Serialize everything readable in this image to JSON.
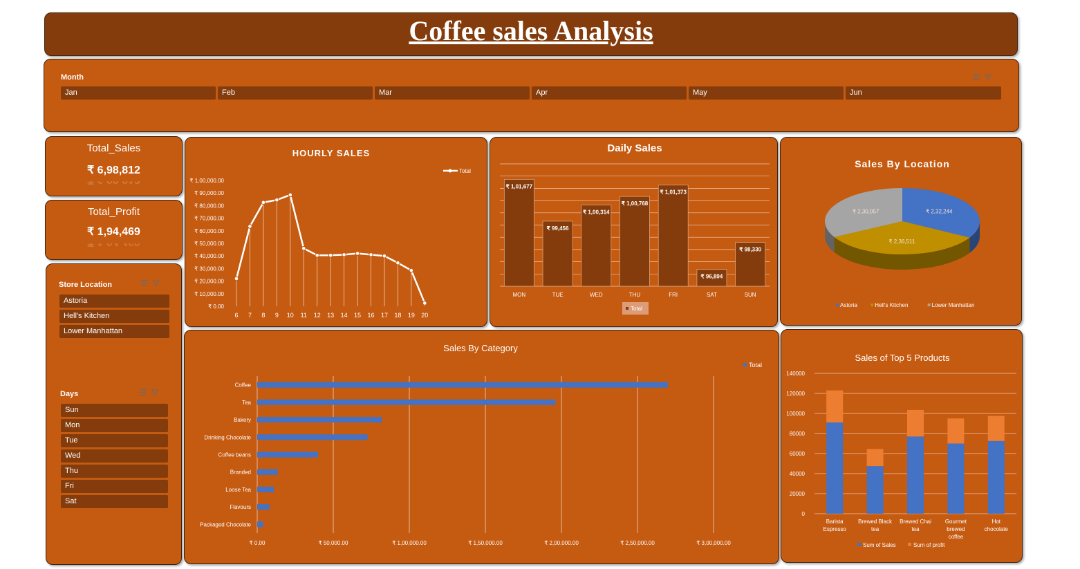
{
  "header": {
    "title": "Coffee sales Analysis"
  },
  "month_slicer": {
    "label": "Month",
    "items": [
      "Jan",
      "Feb",
      "Mar",
      "Apr",
      "May",
      "Jun"
    ]
  },
  "kpis": {
    "total_sales": {
      "label": "Total_Sales",
      "value": "₹ 6,98,812"
    },
    "total_profit": {
      "label": "Total_Profit",
      "value": "₹ 1,94,469"
    }
  },
  "location_slicer": {
    "label": "Store Location",
    "items": [
      "Astoria",
      "Hell's Kitchen",
      "Lower Manhattan"
    ]
  },
  "days_slicer": {
    "label": "Days",
    "items": [
      "Sun",
      "Mon",
      "Tue",
      "Wed",
      "Thu",
      "Fri",
      "Sat"
    ]
  },
  "colors": {
    "panel": "#c55a11",
    "dark": "#843c0c",
    "blue": "#4472c4",
    "orange": "#ed7d31",
    "gold": "#bf8f00",
    "gray": "#a5a5a5"
  },
  "chart_data": [
    {
      "id": "hourly",
      "type": "line",
      "title": "HOURLY SALES",
      "legend": [
        "Total"
      ],
      "x": [
        "6",
        "7",
        "8",
        "9",
        "10",
        "11",
        "12",
        "13",
        "14",
        "15",
        "16",
        "17",
        "18",
        "19",
        "20"
      ],
      "values": [
        22000,
        63500,
        82500,
        84500,
        88500,
        46000,
        40500,
        40500,
        41000,
        42000,
        41000,
        40000,
        34500,
        28500,
        2500
      ],
      "yticks": [
        "₹ 0.00",
        "₹ 10,000.00",
        "₹ 20,000.00",
        "₹ 30,000.00",
        "₹ 40,000.00",
        "₹ 50,000.00",
        "₹ 60,000.00",
        "₹ 70,000.00",
        "₹ 80,000.00",
        "₹ 90,000.00",
        "₹ 1,00,000.00"
      ],
      "ylim": [
        0,
        100000
      ]
    },
    {
      "id": "daily",
      "type": "bar",
      "title": "Daily Sales",
      "legend": [
        "Total"
      ],
      "categories": [
        "MON",
        "TUE",
        "WED",
        "THU",
        "FRI",
        "SAT",
        "SUN"
      ],
      "values": [
        101677,
        99456,
        100314,
        100768,
        101373,
        96894,
        98330
      ],
      "labels": [
        "₹ 1,01,677",
        "₹ 99,456",
        "₹ 1,00,314",
        "₹ 1,00,768",
        "₹ 1,01,373",
        "₹ 96,894",
        "₹ 98,330"
      ],
      "ylim": [
        96000,
        102500
      ]
    },
    {
      "id": "location",
      "type": "pie",
      "title": "Sales By Location",
      "categories": [
        "Astoria",
        "Hell's Kitchen",
        "Lower Manhattan"
      ],
      "values": [
        232244,
        236511,
        230057
      ],
      "labels": [
        "₹ 2,32,244",
        "₹ 2,36,511",
        "₹ 2,30,057"
      ],
      "colors": [
        "#4472c4",
        "#bf8f00",
        "#a5a5a5"
      ]
    },
    {
      "id": "category",
      "type": "bar",
      "orientation": "horizontal",
      "title": "Sales By Category",
      "legend": [
        "Total"
      ],
      "categories": [
        "Coffee",
        "Tea",
        "Bakery",
        "Drinking Chocolate",
        "Coffee beans",
        "Branded",
        "Loose Tea",
        "Flavours",
        "Packaged Chocolate"
      ],
      "values": [
        270000,
        196000,
        82000,
        72500,
        40000,
        13500,
        11000,
        8000,
        4000
      ],
      "xticks": [
        "₹ 0.00",
        "₹ 50,000.00",
        "₹ 1,00,000.00",
        "₹ 1,50,000.00",
        "₹ 2,00,000.00",
        "₹ 2,50,000.00",
        "₹ 3,00,000.00"
      ],
      "xlim": [
        0,
        300000
      ]
    },
    {
      "id": "top5",
      "type": "bar",
      "stacked": true,
      "title": "Sales of Top 5 Products",
      "categories": [
        "Barista Espresso",
        "Brewed Black tea",
        "Brewed Chai tea",
        "Gourmet brewed coffee",
        "Hot chocolate"
      ],
      "series": [
        {
          "name": "Sum of Sales",
          "values": [
            91000,
            47500,
            77000,
            70000,
            72500
          ]
        },
        {
          "name": "Sum of profit",
          "values": [
            32000,
            17000,
            26500,
            25000,
            25000
          ]
        }
      ],
      "yticks": [
        "0",
        "20000",
        "40000",
        "60000",
        "80000",
        "100000",
        "120000",
        "140000"
      ],
      "ylim": [
        0,
        140000
      ]
    }
  ]
}
